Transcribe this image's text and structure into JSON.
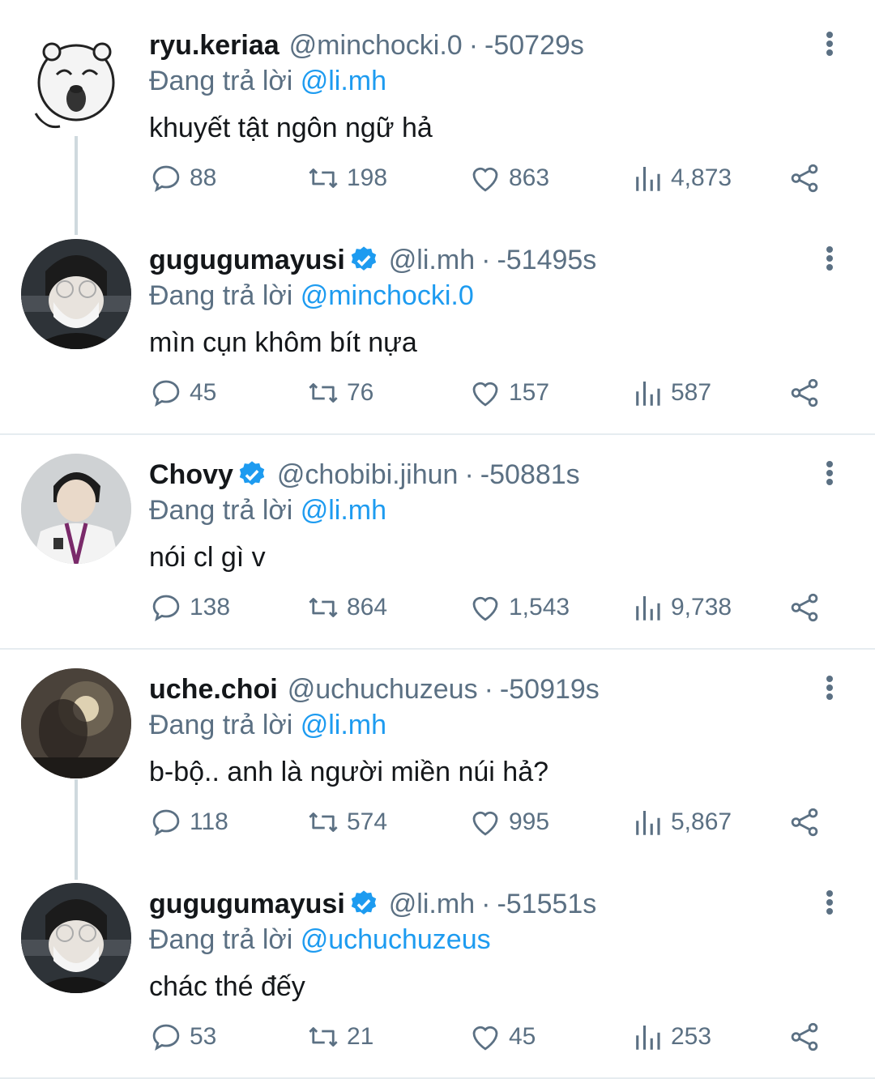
{
  "tweets": [
    {
      "name": "ryu.keriaa",
      "verified": false,
      "handle": "@minchocki.0",
      "dot": "·",
      "time": "-50729s",
      "reply_prefix": "Đang trả lời",
      "reply_to": "@li.mh",
      "text": "khuyết tật ngôn ngữ hả",
      "comments": "88",
      "retweets": "198",
      "likes": "863",
      "views": "4,873"
    },
    {
      "name": "gugugumayusi",
      "verified": true,
      "handle": "@li.mh",
      "dot": "·",
      "time": "-51495s",
      "reply_prefix": "Đang trả lời",
      "reply_to": "@minchocki.0",
      "text": "mìn cụn khôm bít nựa",
      "comments": "45",
      "retweets": "76",
      "likes": "157",
      "views": "587"
    },
    {
      "name": "Chovy",
      "verified": true,
      "handle": "@chobibi.jihun",
      "dot": "·",
      "time": "-50881s",
      "reply_prefix": "Đang trả lời",
      "reply_to": "@li.mh",
      "text": "nói cl gì v",
      "comments": "138",
      "retweets": "864",
      "likes": "1,543",
      "views": "9,738"
    },
    {
      "name": "uche.choi",
      "verified": false,
      "handle": "@uchuchuzeus",
      "dot": "·",
      "time": "-50919s",
      "reply_prefix": "Đang trả lời",
      "reply_to": "@li.mh",
      "text": "b-bộ.. anh là người miền núi hả?",
      "comments": "118",
      "retweets": "574",
      "likes": "995",
      "views": "5,867"
    },
    {
      "name": "gugugumayusi",
      "verified": true,
      "handle": "@li.mh",
      "dot": "·",
      "time": "-51551s",
      "reply_prefix": "Đang trả lời",
      "reply_to": "@uchuchuzeus",
      "text": "chác thé đếy",
      "comments": "53",
      "retweets": "21",
      "likes": "45",
      "views": "253"
    }
  ],
  "icons": {
    "comment": "comment-icon",
    "retweet": "retweet-icon",
    "like": "heart-icon",
    "views": "views-icon",
    "share": "share-icon",
    "more": "more-vertical-icon",
    "verified": "verified-badge-icon"
  },
  "colors": {
    "text": "#14171a",
    "secondary": "#5b7083",
    "mention": "#1d9bf0",
    "verified": "#1d9bf0",
    "divider": "#e6ecf0",
    "thread_line": "#cfd9de"
  }
}
